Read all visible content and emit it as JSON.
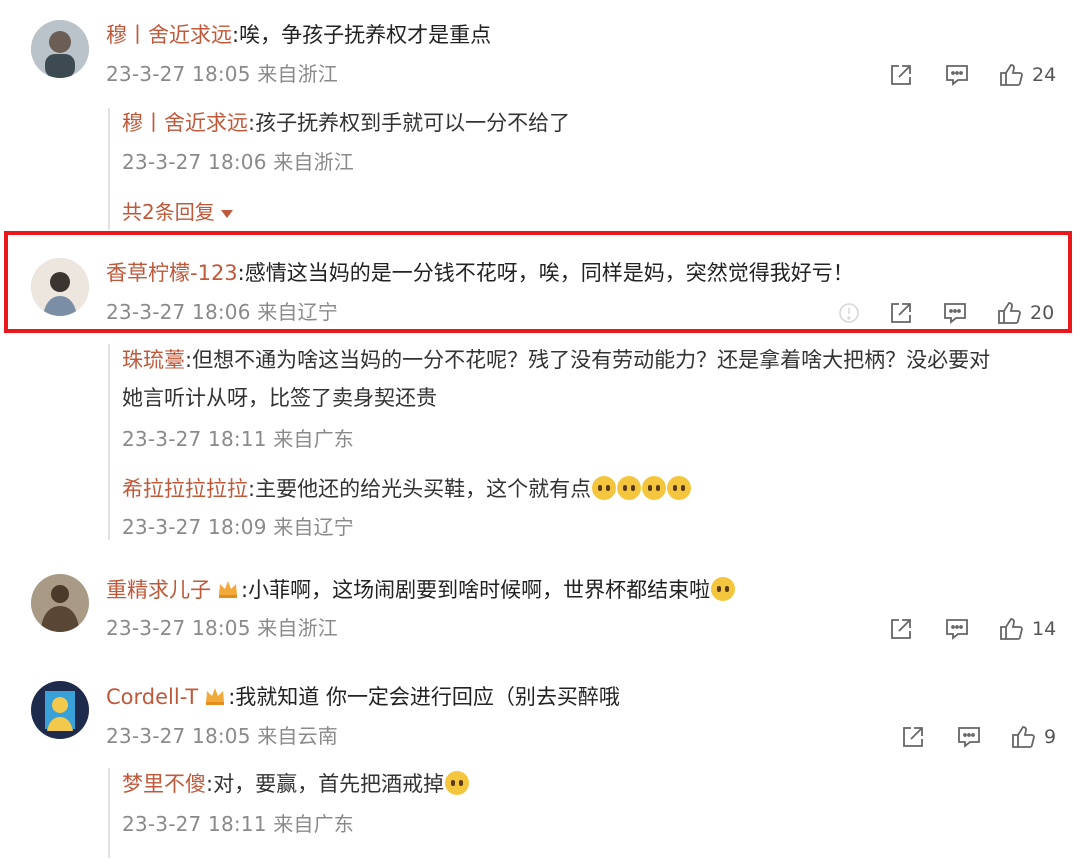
{
  "comments": [
    {
      "user": "穆丨舍近求远",
      "text": ":唉，争孩子抚养权才是重点",
      "meta": "23-3-27 18:05 来自浙江",
      "likes": "24",
      "replies": [
        {
          "user": "穆丨舍近求远",
          "text": ":孩子抚养权到手就可以一分不给了",
          "meta": "23-3-27 18:06 来自浙江"
        }
      ],
      "more_replies": "共2条回复"
    },
    {
      "user": "香草柠檬-123",
      "text": ":感情这当妈的是一分钱不花呀，唉，同样是妈，突然觉得我好亏！",
      "meta": "23-3-27 18:06 来自辽宁",
      "likes": "20",
      "replies": [
        {
          "user": "珠琉薹",
          "text_line1": ":但想不通为啥这当妈的一分不花呢？残了没有劳动能力？还是拿着啥大把柄？没必要对",
          "text_line2": "她言听计从呀，比签了卖身契还贵",
          "meta": "23-3-27 18:11 来自广东"
        },
        {
          "user": "希拉拉拉拉拉",
          "text": ":主要他还的给光头买鞋，这个就有点",
          "meta": "23-3-27 18:09 来自辽宁"
        }
      ]
    },
    {
      "user": "重精求儿子",
      "text": ":小菲啊，这场闹剧要到啥时候啊，世界杯都结束啦",
      "meta": "23-3-27 18:05 来自浙江",
      "likes": "14"
    },
    {
      "user": "Cordell-T",
      "text": ":我就知道 你一定会进行回应（别去买醉哦",
      "meta": "23-3-27 18:05 来自云南",
      "likes": "9",
      "replies": [
        {
          "user": "梦里不傻",
          "text": ":对，要赢，首先把酒戒掉",
          "meta": "23-3-27 18:11 来自广东"
        }
      ]
    }
  ],
  "colors": {
    "username": "#c0583a",
    "highlight_border": "#e8181d",
    "meta": "#8a8a8a"
  },
  "icons": [
    "share-icon",
    "comment-icon",
    "like-icon",
    "report-icon",
    "crown-icon",
    "emoji-icon"
  ]
}
